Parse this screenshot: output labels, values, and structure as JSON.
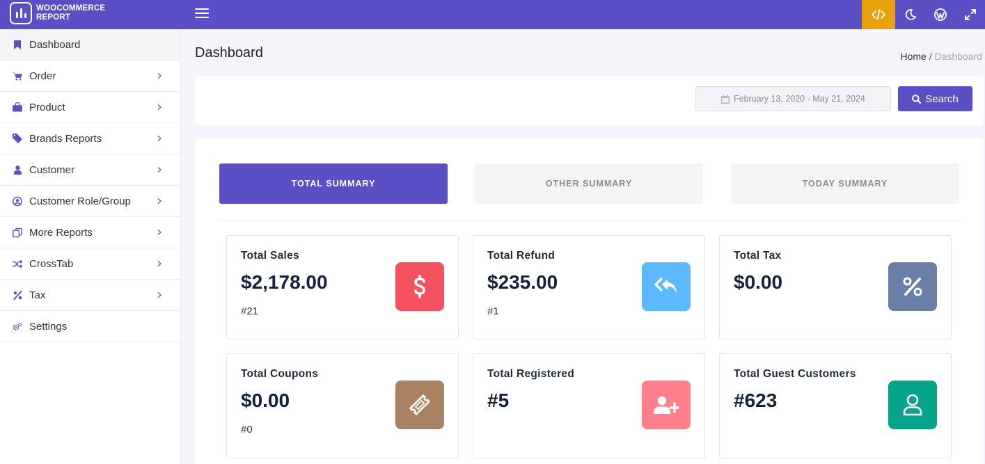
{
  "app": {
    "logo_line1": "WOOCOMMERCE",
    "logo_line2": "REPORT"
  },
  "colors": {
    "primary": "#5a4fc4",
    "code_btn": "#e8a20c",
    "sales": "#f5515f",
    "refund": "#5cb8ff",
    "tax": "#6a7fa8",
    "coupons": "#a98163",
    "registered": "#ff7f8a",
    "guest": "#06a48a"
  },
  "topbar": {
    "icons": [
      "code-icon",
      "moon-icon",
      "wordpress-icon",
      "expand-icon"
    ]
  },
  "sidebar": {
    "items": [
      {
        "label": "Dashboard",
        "icon": "bookmark-icon"
      },
      {
        "label": "Order",
        "icon": "cart-icon"
      },
      {
        "label": "Product",
        "icon": "bag-icon"
      },
      {
        "label": "Brands Reports",
        "icon": "tag-icon"
      },
      {
        "label": "Customer",
        "icon": "user-icon"
      },
      {
        "label": "Customer Role/Group",
        "icon": "user-circle-icon"
      },
      {
        "label": "More Reports",
        "icon": "copy-icon"
      },
      {
        "label": "CrossTab",
        "icon": "shuffle-icon"
      },
      {
        "label": "Tax",
        "icon": "percent-icon"
      },
      {
        "label": "Settings",
        "icon": "gears-icon"
      }
    ]
  },
  "page": {
    "title": "Dashboard",
    "breadcrumb_home": "Home",
    "breadcrumb_sep": " / ",
    "breadcrumb_current": "Dashboard"
  },
  "search": {
    "date_range": "February 13, 2020 - May 21, 2024",
    "button": "Search"
  },
  "tabs": [
    "TOTAL SUMMARY",
    "OTHER SUMMARY",
    "TODAY SUMMARY"
  ],
  "stats": [
    {
      "title": "Total Sales",
      "value": "$2,178.00",
      "sub": "#21",
      "icon": "dollar-icon"
    },
    {
      "title": "Total Refund",
      "value": "$235.00",
      "sub": "#1",
      "icon": "reply-all-icon"
    },
    {
      "title": "Total Tax",
      "value": "$0.00",
      "sub": "",
      "icon": "percent-icon"
    },
    {
      "title": "Total Coupons",
      "value": "$0.00",
      "sub": "#0",
      "icon": "ticket-icon"
    },
    {
      "title": "Total Registered",
      "value": "#5",
      "sub": "",
      "icon": "user-plus-icon"
    },
    {
      "title": "Total Guest Customers",
      "value": "#623",
      "sub": "",
      "icon": "user-icon"
    }
  ]
}
